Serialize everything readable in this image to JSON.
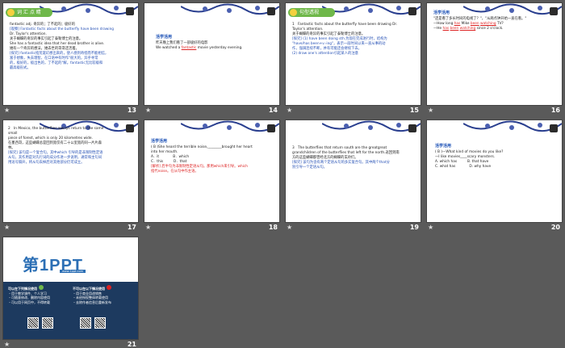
{
  "slides": [
    {
      "num": "13",
      "heading": "词 汇 点 睛",
      "lines": [
        "fantastic adj. 奇异的；了不起的；极好的",
        "[观察] Fantastic facts about the butterfly have been drawing",
        "Dr. Taylor's attention.",
        "关于蝴蝶的奇异的事实引起了泰勒博士的注意。",
        "She has a fantastic idea that her dead brother is alive.",
        "她有一个奇异的想法，她去世的哥哥还活着。",
        "[探究] fantastic指荒诞幻想出来的，使人感到奇怪而不能相信，",
        "富于想象，失去理智，在口语中有时作\"很大的，异乎寻常",
        "的，极好的，极出色的，了不起的\"解。fantastic无比较级和",
        "最高级形式。"
      ]
    },
    {
      "num": "14",
      "title": "活学活用",
      "lines": [
        "昨天晚上我们看了一部极好的电影",
        "We watched a ",
        "fantastic",
        " movie yesterday evening."
      ]
    },
    {
      "num": "15",
      "heading": "句型透视",
      "lines": [
        "1　Fantastic facts about the butterfly have been drawing Dr.",
        "Taylor's attention.",
        "关于蝴蝶的奇异的事实引起了泰勒博士的注意。",
        "[探究] (1) have been doing sth.为现在完成进行时，结构为",
        "\"have/has been+v.-ing\"，表示一段时间以来一直从事的动",
        "作，强调连续不断，并有可能还会继续下去。",
        "(2) draw one's attention引起某人的注意"
      ]
    },
    {
      "num": "16",
      "title": "活学活用",
      "lines": [
        "\"还是看了多长时间的电视了？\"，\"从两点钟开始一直在看。\"",
        "—How long ",
        "has",
        " Mike ",
        "been",
        " ",
        "watching",
        " TV?",
        "—He ",
        "has",
        " ",
        "been",
        " ",
        "watching",
        " since 2 o'clock."
      ]
    },
    {
      "num": "17",
      "lines": [
        "2　In Mexico, the butterflies always return to the same small",
        "piece of forest, which is only 20 kilometres wide.",
        "在墨西哥，这些蝴蝶总是回到宽仅有二十公里宽的同一片片森林。",
        "[探究] 该句是一个复合句。其中which 引导的是非限制性定语",
        "从句。其作用是对先行词的成分作进一步说明，通常和主句间",
        "用逗号隔开，将从句去掉后对其他部分仍可成立。"
      ]
    },
    {
      "num": "18",
      "title": "活学活用",
      "lines": [
        "( B )She heard the terrible noise,________brought her heart",
        "into her mouth.",
        "A．it　　　　B．which",
        "C．this　　　D．that",
        "[解析] 后半句为非限制性定语从句。那用which来引导。which",
        "指代noise。在从句中作主语。"
      ]
    },
    {
      "num": "19",
      "lines": [
        "3　The butterflies that return south are the greatgreat",
        "grandchildren of the butterflies that left for the north.返回到南",
        "方的这些蝴蝶都曾经北方的蝴蝶的玄孙们。",
        "[探究] 该句为含有两个定语从句的多实复合句。其中两个that分",
        "别引导一个定语从句。"
      ]
    },
    {
      "num": "20",
      "title": "活学活用",
      "lines": [
        "( B )—What kind of movies do you like?",
        "—I like movies____scary monsters.",
        "A. which has　　　B. that have",
        "C. what has　　　　D. why have"
      ]
    },
    {
      "num": "21",
      "logo_text": "第1PPT",
      "logo_sub": "www.1ppt.com",
      "left_title": "可以在下列情况使用",
      "left_lines": [
        "・用于教学课件、个人学习",
        "・可随意修改、删除内容使用",
        "・可以用于网页中，不得转载"
      ],
      "right_title": "不可以在以下情况使用",
      "right_lines": [
        "・用于商业用途销售",
        "・未经授权整体转载使用",
        "・去除作者信息后重新发布"
      ]
    }
  ],
  "colors": {
    "background": "#5a5a5a",
    "selection": "#f6c844",
    "answer": "#d22222",
    "label": "#1a4fb5"
  }
}
